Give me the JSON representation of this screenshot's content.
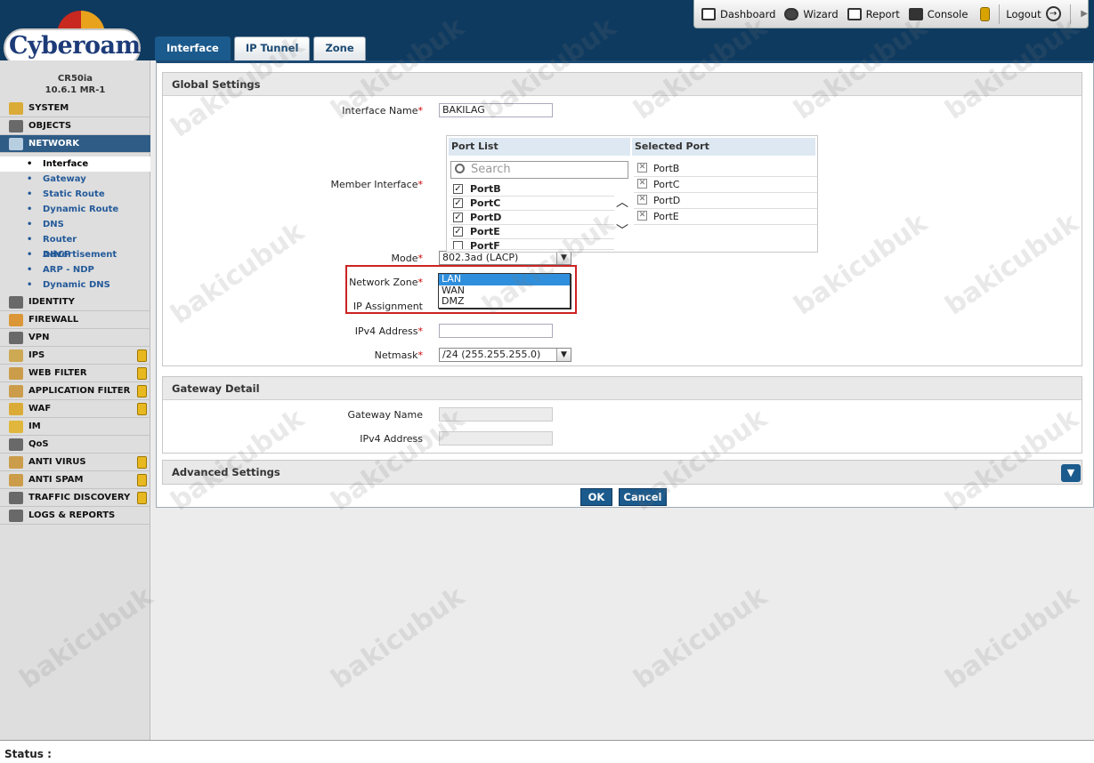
{
  "brand": {
    "logo_text": "Cyberoam"
  },
  "device": {
    "model": "CR50ia",
    "version": "10.6.1 MR-1"
  },
  "topbar": {
    "dashboard": "Dashboard",
    "wizard": "Wizard",
    "report": "Report",
    "console": "Console",
    "logout": "Logout"
  },
  "tabs": [
    "Interface",
    "IP Tunnel",
    "Zone"
  ],
  "sidebar": {
    "sections": [
      {
        "label": "SYSTEM"
      },
      {
        "label": "OBJECTS"
      },
      {
        "label": "NETWORK"
      },
      {
        "label": "IDENTITY"
      },
      {
        "label": "FIREWALL"
      },
      {
        "label": "VPN"
      },
      {
        "label": "IPS"
      },
      {
        "label": "WEB FILTER"
      },
      {
        "label": "APPLICATION FILTER"
      },
      {
        "label": "WAF"
      },
      {
        "label": "IM"
      },
      {
        "label": "QoS"
      },
      {
        "label": "ANTI VIRUS"
      },
      {
        "label": "ANTI SPAM"
      },
      {
        "label": "TRAFFIC DISCOVERY"
      },
      {
        "label": "LOGS & REPORTS"
      }
    ],
    "network_items": [
      "Interface",
      "Gateway",
      "Static Route",
      "Dynamic Route",
      "DNS",
      "Router Advertisement",
      "DHCP",
      "ARP - NDP",
      "Dynamic DNS"
    ]
  },
  "global": {
    "title": "Global Settings",
    "interface_name_label": "Interface Name",
    "interface_name_value": "BAKILAG",
    "member_interface_label": "Member Interface",
    "port_list_header": "Port List",
    "selected_port_header": "Selected Port",
    "search_placeholder": "Search",
    "ports": [
      "PortB",
      "PortC",
      "PortD",
      "PortE",
      "PortF"
    ],
    "selected_ports": [
      "PortB",
      "PortC",
      "PortD",
      "PortE"
    ],
    "mode_label": "Mode",
    "mode_value": "802.3ad (LACP)",
    "network_zone_label": "Network Zone",
    "zone_options": [
      "LAN",
      "WAN",
      "DMZ"
    ],
    "ip_assignment_label": "IP Assignment",
    "ipv4_label": "IPv4 Address",
    "netmask_label": "Netmask",
    "netmask_value": "/24 (255.255.255.0)"
  },
  "gateway": {
    "title": "Gateway Detail",
    "name_label": "Gateway Name",
    "ipv4_label": "IPv4 Address"
  },
  "advanced": {
    "title": "Advanced Settings"
  },
  "buttons": {
    "ok": "OK",
    "cancel": "Cancel"
  },
  "status": {
    "label": "Status :"
  },
  "watermark": "bakicubuk",
  "colors": {
    "header": "#0f3a5f",
    "accent": "#1b5a8c",
    "highlight": "#cc2222"
  }
}
